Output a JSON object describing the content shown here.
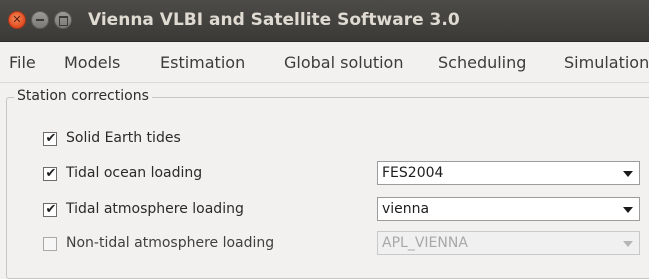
{
  "window": {
    "title": "Vienna VLBI and Satellite Software 3.0",
    "close_symbol": "✕"
  },
  "menu": {
    "items": [
      "File",
      "Models",
      "Estimation",
      "Global solution",
      "Scheduling",
      "Simulation"
    ]
  },
  "station_corrections": {
    "title": "Station corrections",
    "options": [
      {
        "label": "Solid Earth tides",
        "checked": true
      },
      {
        "label": "Tidal ocean loading",
        "checked": true,
        "model": "FES2004"
      },
      {
        "label": "Tidal atmosphere loading",
        "checked": true,
        "model": "vienna"
      },
      {
        "label": "Non-tidal atmosphere loading",
        "checked": false,
        "model": "APL_VIENNA"
      }
    ],
    "check_symbol": "✔"
  },
  "colors": {
    "titlebar": "#3b3a36",
    "close_button": "#df4a1e",
    "window_background": "#f2f1f0"
  }
}
